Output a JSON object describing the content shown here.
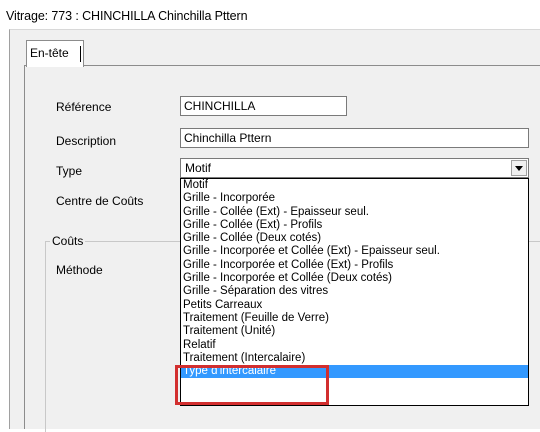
{
  "window": {
    "title": "Vitrage: 773 : CHINCHILLA Chinchilla Pttern"
  },
  "tabs": [
    {
      "label": "En-tête"
    }
  ],
  "form": {
    "reference_label": "Référence",
    "reference_value": "CHINCHILLA",
    "description_label": "Description",
    "description_value": "Chinchilla Pttern",
    "type_label": "Type",
    "type_value": "Motif",
    "centre_label": "Centre de Coûts"
  },
  "couts_group": {
    "title": "Coûts",
    "methode_label": "Méthode"
  },
  "dropdown": {
    "selected_index": 14,
    "options": [
      "Motif",
      "Grille - Incorporée",
      "Grille - Collée (Ext) - Epaisseur seul.",
      "Grille - Collée (Ext) - Profils",
      "Grille - Collée (Deux cotés)",
      "Grille - Incorporée et Collée (Ext) - Epaisseur seul.",
      "Grille - Incorporée et Collée (Ext) - Profils",
      "Grille - Incorporée et Collée (Deux cotés)",
      "Grille - Séparation des vitres",
      "Petits Carreaux",
      "Traitement (Feuille de Verre)",
      "Traitement (Unité)",
      "Relatif",
      "Traitement (Intercalaire)",
      "Type d'intercalaire"
    ]
  },
  "colors": {
    "selection": "#3399ff",
    "annotation": "#d22f2f"
  }
}
